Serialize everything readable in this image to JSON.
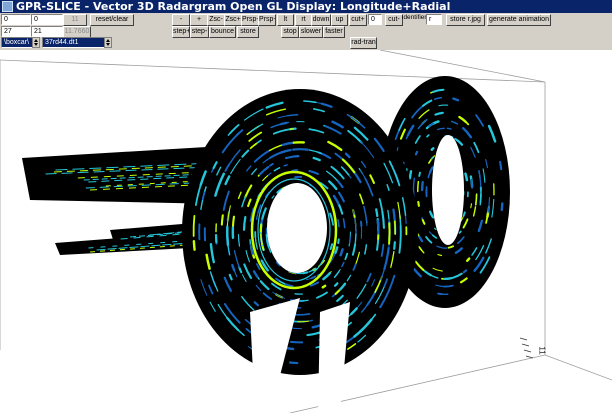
{
  "window": {
    "title": "GPR-SLICE -  Vector 3D Radargram Open GL Display:     Longitude+Radial"
  },
  "toolbar": {
    "field_a": "0",
    "field_b": "0",
    "field_c": "27",
    "field_d": "21",
    "button_11": "11",
    "button_11_7660": "11.7660",
    "reset_clear": "reset/clear",
    "folder": "\\boxcar\\",
    "filename": "37rd44.dt1",
    "minus": "-",
    "plus": "+",
    "zsc_minus": "Zsc-",
    "zsc_plus": "Zsc+",
    "prsp_minus": "Prsp-",
    "prsp_plus": "Prsp+",
    "lt": "lt",
    "rt": "rt",
    "down": "down",
    "up": "up",
    "cut_plus": "cut+",
    "cut_value": "0",
    "cut_minus": "cut-",
    "identifier_label": "identifier",
    "identifier_value": "r",
    "store_r_jpg": "store r.jpg",
    "generate_animation": "generate animation",
    "step_plus": "step+",
    "step_minus": "step-",
    "bounce": "bounce",
    "store": "store",
    "stop": "stop",
    "slower": "slower",
    "faster": "faster",
    "rad_tran": "rad-tran"
  },
  "view": {
    "axis_tick_label": "11",
    "colors": {
      "background": "#ffffff",
      "slice": "#000000",
      "reflection_low": "#1565c0",
      "reflection_mid": "#26c6da",
      "reflection_high": "#c6ff00",
      "bounding_box": "#9e9e9e"
    }
  }
}
